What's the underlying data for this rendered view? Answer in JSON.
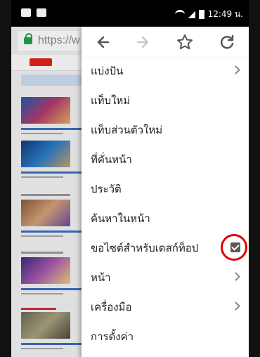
{
  "status_bar": {
    "time": "12:49 น."
  },
  "browser": {
    "url_text": "https://w"
  },
  "menu": {
    "items": [
      {
        "label": "แบ่งปัน",
        "chevron": true,
        "checkbox": false
      },
      {
        "label": "แท็บใหม่",
        "chevron": false,
        "checkbox": false
      },
      {
        "label": "แท็บส่วนตัวใหม่",
        "chevron": false,
        "checkbox": false
      },
      {
        "label": "ที่คั่นหน้า",
        "chevron": false,
        "checkbox": false
      },
      {
        "label": "ประวัติ",
        "chevron": false,
        "checkbox": false
      },
      {
        "label": "ค้นหาในหน้า",
        "chevron": false,
        "checkbox": false
      },
      {
        "label": "ขอไซต์สำหรับเดสก์ท็อป",
        "chevron": false,
        "checkbox": true,
        "checked": true
      },
      {
        "label": "หน้า",
        "chevron": true,
        "checkbox": false
      },
      {
        "label": "เครื่องมือ",
        "chevron": true,
        "checkbox": false
      },
      {
        "label": "การตั้งค่า",
        "chevron": false,
        "checkbox": false
      }
    ]
  },
  "colors": {
    "highlight_circle": "#e00000",
    "lock_green": "#1fa34a"
  }
}
